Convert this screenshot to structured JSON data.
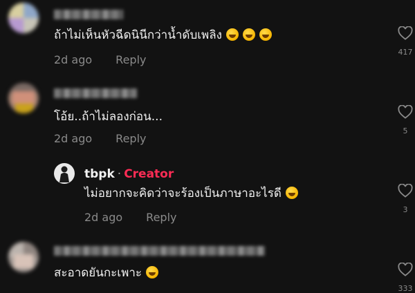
{
  "colors": {
    "background": "#121212",
    "text_primary": "#f1f1f1",
    "text_secondary": "#8a8a8a",
    "creator_accent": "#fe2c55"
  },
  "comments": [
    {
      "text": "ถ้าไม่เห็นหัวฉีดนินีกว่าน้ำดับเพลิง",
      "emojis": [
        "rolling-on-floor-laughing-emoji",
        "rolling-on-floor-laughing-emoji",
        "rolling-on-floor-laughing-emoji"
      ],
      "time": "2d ago",
      "reply_label": "Reply",
      "like_count": "417"
    },
    {
      "text": "โอ้ย..ถ้าไม่ลองก่อน...",
      "time": "2d ago",
      "reply_label": "Reply",
      "like_count": "5"
    },
    {
      "author": "tbpk",
      "separator": "·",
      "badge": "Creator",
      "text": "ไม่อยากจะคิดว่าจะร้องเป็นภาษาอะไรดี",
      "emojis": [
        "grinning-squinting-emoji"
      ],
      "time": "2d ago",
      "reply_label": "Reply",
      "like_count": "3"
    },
    {
      "text": "สะอาดยันกะเพาะ",
      "emojis": [
        "grinning-squinting-emoji"
      ],
      "like_count": "333"
    }
  ]
}
